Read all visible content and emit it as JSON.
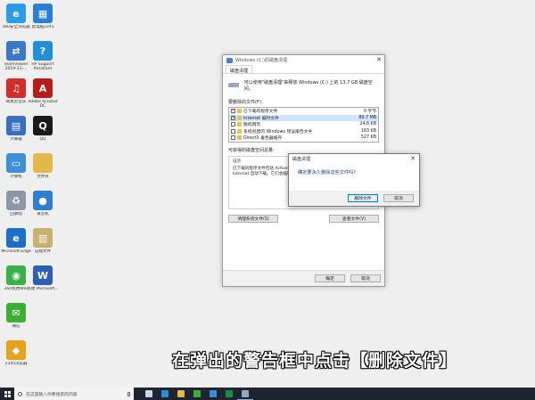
{
  "desktop_icons": [
    {
      "name": "ie-icon",
      "label": "360安全浏览器",
      "color": "#2e9be8",
      "glyph": "e",
      "col": 0,
      "row": 0
    },
    {
      "name": "pc-icon",
      "label": "此电脑2345",
      "color": "#2a7fd4",
      "glyph": "▦",
      "col": 1,
      "row": 0
    },
    {
      "name": "teamviewer-icon",
      "label": "TeamViewer 2019-11-...",
      "color": "#3a78c8",
      "glyph": "⇄",
      "col": 0,
      "row": 1
    },
    {
      "name": "help-icon",
      "label": "HP Support Assistant",
      "color": "#2290d8",
      "glyph": "?",
      "col": 1,
      "row": 1
    },
    {
      "name": "netease-music-icon",
      "label": "网易云音乐",
      "color": "#d22c2c",
      "glyph": "♫",
      "col": 0,
      "row": 2
    },
    {
      "name": "acrobat-icon",
      "label": "Adobe Acrobat DC",
      "color": "#b51c1c",
      "glyph": "A",
      "col": 1,
      "row": 2
    },
    {
      "name": "calculator-icon",
      "label": "计算器",
      "color": "#3a6fc0",
      "glyph": "▤",
      "col": 0,
      "row": 3
    },
    {
      "name": "qq-icon",
      "label": "QQ",
      "color": "#1a1a1a",
      "glyph": "Q",
      "col": 1,
      "row": 3
    },
    {
      "name": "computer-icon",
      "label": "计算机",
      "color": "#3f8fd8",
      "glyph": "▭",
      "col": 0,
      "row": 4
    },
    {
      "name": "folder-icon",
      "label": "文件夹",
      "color": "#e2b94a",
      "glyph": "",
      "col": 1,
      "row": 4
    },
    {
      "name": "recycle-bin-icon",
      "label": "回收站",
      "color": "#8a98a8",
      "glyph": "♻",
      "col": 0,
      "row": 5
    },
    {
      "name": "recorder-icon",
      "label": "录音机",
      "color": "#2f7fd0",
      "glyph": "●",
      "col": 1,
      "row": 5
    },
    {
      "name": "edge-icon",
      "label": "Microsoft Edge",
      "color": "#1e6fc8",
      "glyph": "e",
      "col": 0,
      "row": 6
    },
    {
      "name": "archive-icon",
      "label": "压缩文件",
      "color": "#c8b070",
      "glyph": "▥",
      "col": 1,
      "row": 6
    },
    {
      "name": "wifi-icon",
      "label": "360免费WiFi",
      "color": "#3bb04a",
      "glyph": "◉",
      "col": 0,
      "row": 7
    },
    {
      "name": "word-icon",
      "label": "新建 Microsoft...",
      "color": "#2b5fb4",
      "glyph": "W",
      "col": 1,
      "row": 7
    },
    {
      "name": "wechat-icon",
      "label": "微信",
      "color": "#3cb034",
      "glyph": "✉",
      "col": 0,
      "row": 8
    },
    {
      "name": "360-icon",
      "label": "2345浏览器",
      "color": "#e5a21e",
      "glyph": "◆",
      "col": 0,
      "row": 9
    }
  ],
  "disk_cleanup": {
    "title": "Windows (C:)的磁盘清理",
    "tab": "磁盘清理",
    "description": "可以使用\"磁盘清理\"来释放 Windows (C:) 上的 13.7 GB 磁盘空间。",
    "files_label": "要删除的文件(F):",
    "files": [
      {
        "name": "已下载的程序文件",
        "size": "0 字节",
        "checked": true
      },
      {
        "name": "Internet 临时文件",
        "size": "89.7 MB",
        "checked": true
      },
      {
        "name": "脱机网页",
        "size": "24.8 KB",
        "checked": false
      },
      {
        "name": "系统创建的 Windows 错误报告文件",
        "size": "183 KB",
        "checked": false
      },
      {
        "name": "DirectX 着色器缓存",
        "size": "527 KB",
        "checked": false
      }
    ],
    "space_label": "可获得的磁盘空间总量:",
    "desc_title": "描述",
    "desc_text": "已下载的程序文件包括 ActiveX 控件和 Java 小程序，浏览特定网页时会从 Internet 自动下载。它们会临时存储在硬盘上的已下载的程序文件夹中。",
    "clean_system_label": "清理系统文件(S)",
    "view_files_label": "查看文件(V)",
    "ok_label": "确定",
    "cancel_label": "取消"
  },
  "confirm_dialog": {
    "title": "磁盘清理",
    "message": "确定要永久删除这些文件吗?",
    "delete_label": "删除文件",
    "cancel_label": "取消"
  },
  "caption": "在弹出的警告框中点击【删除文件】",
  "taskbar": {
    "search_placeholder": "在这里输入你要搜索的内容",
    "apps": [
      {
        "name": "task-view-icon",
        "color": "#cfd6e0"
      },
      {
        "name": "edge-taskbar-icon",
        "color": "#2e8ce0"
      },
      {
        "name": "explorer-taskbar-icon",
        "color": "#e2b94a"
      },
      {
        "name": "wechat-taskbar-icon",
        "color": "#3cb034"
      },
      {
        "name": "browser-taskbar-icon",
        "color": "#3a8ed8"
      },
      {
        "name": "excel-taskbar-icon",
        "color": "#1f8a4c"
      },
      {
        "name": "disk-cleanup-taskbar-icon",
        "color": "#9aa7b8"
      }
    ]
  }
}
